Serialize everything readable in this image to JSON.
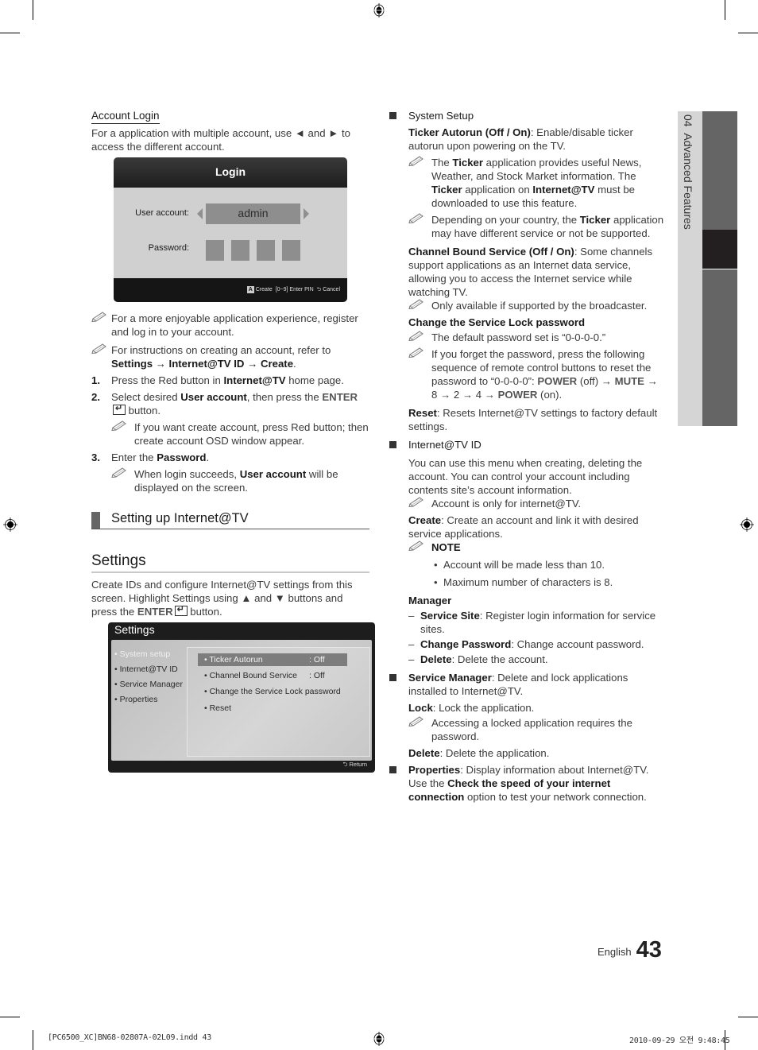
{
  "left": {
    "account_login_heading": "Account Login",
    "account_login_desc_a": "For a application with multiple account, use ",
    "account_login_desc_left": "◄",
    "account_login_desc_and": " and ",
    "account_login_desc_right": "►",
    "account_login_desc_b": " to access the different account.",
    "login_osd": {
      "title": "Login",
      "user_account_label": "User account:",
      "user_account_value": "admin",
      "password_label": "Password:",
      "pin_boxes": 4,
      "footer_a_button": "A",
      "footer_create": "Create",
      "footer_enter_pin": "[0~9] Enter PIN",
      "footer_return_icon": "⮌",
      "footer_cancel": "Cancel"
    },
    "note1": "For a more enjoyable application experience, register and log in to your account.",
    "note2_a": "For instructions on creating an account, refer to ",
    "note2_b": "Settings → Internet@TV ID → Create",
    "note2_c": ".",
    "steps": [
      {
        "num": "1.",
        "a": "Press the Red button in ",
        "b": "Internet@TV",
        "c": " home page."
      },
      {
        "num": "2.",
        "a": "Select desired ",
        "b": "User account",
        "c": ", then press the ",
        "d": "ENTER",
        "e": " button.",
        "note": "If you want create account, press Red button; then create account OSD window appear."
      },
      {
        "num": "3.",
        "a": "Enter the ",
        "b": "Password",
        "c": ".",
        "note_a": "When login succeeds, ",
        "note_b": "User account",
        "note_c": " will be displayed on the screen."
      }
    ],
    "section_heading": "Setting up Internet@TV",
    "settings_title": "Settings",
    "settings_desc_a": "Create IDs and configure Internet@TV settings from this screen. Highlight Settings using ▲ and ▼ buttons and press the ",
    "settings_desc_enter": "ENTER",
    "settings_desc_b": " button.",
    "settings_osd": {
      "title": "Settings",
      "menu": [
        "• System setup",
        "• Internet@TV ID",
        "• Service Manager",
        "• Properties"
      ],
      "options": [
        {
          "label": "• Ticker Autorun",
          "value": ": Off",
          "selected": true
        },
        {
          "label": "• Channel Bound Service",
          "value": ": Off"
        },
        {
          "label": "• Change the Service Lock password",
          "value": ""
        },
        {
          "label": "• Reset",
          "value": ""
        }
      ],
      "footer_return_icon": "⮌",
      "footer_return": "Return"
    }
  },
  "right": {
    "system_setup": "System Setup",
    "ticker_title": "Ticker Autorun (Off / On)",
    "ticker_desc": ": Enable/disable ticker autorun upon powering on the TV.",
    "ticker_note1_a": "The ",
    "ticker_note1_b": "Ticker",
    "ticker_note1_c": " application provides useful News, Weather, and Stock Market information. The ",
    "ticker_note1_d": "Ticker",
    "ticker_note1_e": " application on ",
    "ticker_note1_f": "Internet@TV",
    "ticker_note1_g": " must be downloaded to use this feature.",
    "ticker_note2_a": "Depending on your country, the ",
    "ticker_note2_b": "Ticker",
    "ticker_note2_c": " application may have different service or not be supported.",
    "cbs_title": "Channel Bound Service (Off / On)",
    "cbs_desc": ": Some channels support applications as an Internet data service, allowing you to access the Internet service while watching TV.",
    "cbs_note": "Only available if supported by the broadcaster.",
    "lock_title": "Change the Service Lock password",
    "lock_note1": "The default password set is “0-0-0-0.”",
    "lock_note2_a": "If you forget the password, press the following sequence of remote control buttons to reset the password to “0-0-0-0”: ",
    "lock_note2_power1": "POWER",
    "lock_note2_off": " (off) → ",
    "lock_note2_mute": "MUTE",
    "lock_note2_seq": " → 8 → 2 → 4 → ",
    "lock_note2_power2": "POWER",
    "lock_note2_on": " (on).",
    "reset_title": "Reset",
    "reset_desc": ": Resets Internet@TV settings to factory default settings.",
    "id_heading": "Internet@TV ID",
    "id_desc": "You can use this menu when creating, deleting the account. You can control your account including contents site’s account information.",
    "id_note": "Account is only for internet@TV.",
    "create_title": "Create",
    "create_desc": ": Create an account and link it with desired service applications.",
    "note_label": "NOTE",
    "note_bullets": [
      "Account will be made less than 10.",
      "Maximum number of characters is 8."
    ],
    "manager_title": "Manager",
    "manager_items": [
      {
        "b": "Service Site",
        "t": ": Register login information for service sites."
      },
      {
        "b": "Change Password",
        "t": ": Change account password."
      },
      {
        "b": "Delete",
        "t": ": Delete the account."
      }
    ],
    "sm_title": "Service Manager",
    "sm_desc": ": Delete and lock applications installed to Internet@TV.",
    "lock_app_title": "Lock",
    "lock_app_desc": ": Lock the application.",
    "lock_app_note": "Accessing a locked application requires the password.",
    "delete_title": "Delete",
    "delete_desc": ": Delete the application.",
    "prop_title": "Properties",
    "prop_desc_a": ": Display information about Internet@TV. Use the ",
    "prop_desc_b": "Check the speed of your internet connection",
    "prop_desc_c": " option to test your network connection."
  },
  "side_tab": {
    "chapter": "04",
    "label": "Advanced Features"
  },
  "footer": {
    "language": "English",
    "page_number": "43"
  },
  "slug": {
    "file": "[PC6500_XC]BN68-02807A-02L09.indd   43",
    "timestamp": "2010-09-29   오전 9:48:45"
  }
}
